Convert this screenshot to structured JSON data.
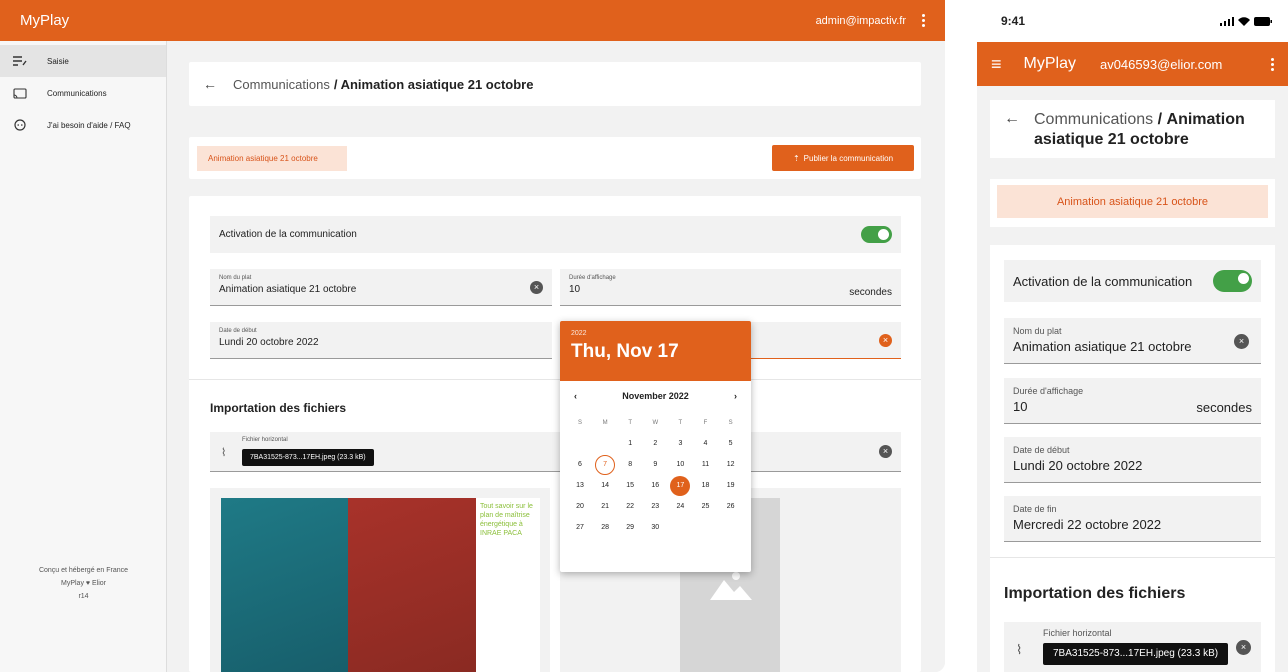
{
  "app": {
    "brand": "MyPlay",
    "user": "admin@impactiv.fr"
  },
  "sidebar": {
    "items": [
      {
        "label": "Saisie",
        "icon": "edit-list-icon"
      },
      {
        "label": "Communications",
        "icon": "cast-icon"
      },
      {
        "label": "J'ai besoin d'aide / FAQ",
        "icon": "help-face-icon"
      }
    ],
    "footer": {
      "line1": "Conçu et hébergé en France",
      "line2": "MyPlay ♥ Elior",
      "line3": "r14"
    }
  },
  "breadcrumb": {
    "parent": "Communications",
    "separator": "/",
    "current": "Animation asiatique 21 octobre"
  },
  "publish": {
    "tag": "Animation asiatique 21 octobre",
    "button": "Publier la communication"
  },
  "form": {
    "activation_label": "Activation de la communication",
    "dish_label": "Nom du plat",
    "dish_value": "Animation asiatique 21 octobre",
    "duration_label": "Durée d'affichage",
    "duration_value": "10",
    "duration_unit": "secondes",
    "start_label": "Date de début",
    "start_value": "Lundi 20 octobre 2022"
  },
  "files": {
    "section_title": "Importation des fichiers",
    "horizontal_label": "Fichier horizontal",
    "horizontal_file": "7BA31525-873...17EH.jpeg (23.3 kB)",
    "poster_text": "Tout savoir sur le plan de maîtrise énergétique à INRAE PACA"
  },
  "datepicker": {
    "year": "2022",
    "date": "Thu, Nov 17",
    "month": "November 2022",
    "weekdays": [
      "S",
      "M",
      "T",
      "W",
      "T",
      "F",
      "S"
    ],
    "days": [
      "1",
      "2",
      "3",
      "4",
      "5",
      "6",
      "7",
      "8",
      "9",
      "10",
      "11",
      "12",
      "13",
      "14",
      "15",
      "16",
      "17",
      "18",
      "19",
      "20",
      "21",
      "22",
      "23",
      "24",
      "25",
      "26",
      "27",
      "28",
      "29",
      "30"
    ],
    "today": "7",
    "selected": "17"
  },
  "mobile": {
    "time": "9:41",
    "brand": "MyPlay",
    "user": "av046593@elior.com",
    "breadcrumb_parent": "Communications",
    "breadcrumb_current": "Animation asiatique 21 octobre",
    "tag": "Animation asiatique 21 octobre",
    "activation_label": "Activation de la communication",
    "dish_label": "Nom du plat",
    "dish_value": "Animation asiatique 21 octobre",
    "duration_label": "Durée d'affichage",
    "duration_value": "10",
    "duration_unit": "secondes",
    "start_label": "Date de début",
    "start_value": "Lundi 20 octobre 2022",
    "end_label": "Date de fin",
    "end_value": "Mercredi 22 octobre 2022",
    "section_title": "Importation des fichiers",
    "file_label": "Fichier horizontal",
    "file_value": "7BA31525-873...17EH.jpeg (23.3 kB)"
  },
  "colors": {
    "accent": "#e0611c",
    "toggle_on": "#43a047"
  }
}
